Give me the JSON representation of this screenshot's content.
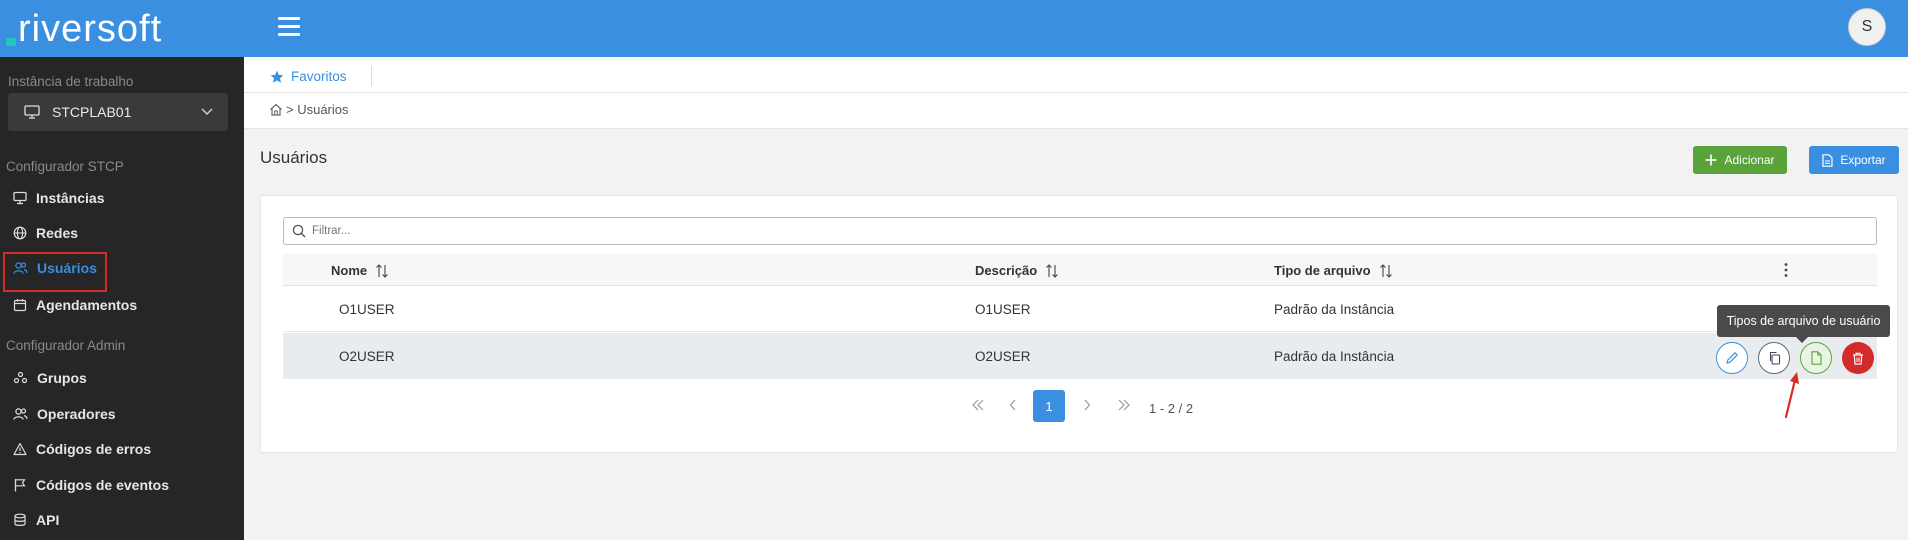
{
  "app": {
    "logo_text": "riversoft",
    "user_initial": "S"
  },
  "sidebar": {
    "instance_label": "Instância de trabalho",
    "instance_value": "STCPLAB01",
    "section_stcp": "Configurador STCP",
    "section_admin": "Configurador Admin",
    "items": [
      {
        "label": "Instâncias",
        "icon": "monitor-icon"
      },
      {
        "label": "Redes",
        "icon": "globe-icon"
      },
      {
        "label": "Usuários",
        "icon": "users-icon",
        "active": true
      },
      {
        "label": "Agendamentos",
        "icon": "calendar-icon"
      },
      {
        "label": "Grupos",
        "icon": "group-icon"
      },
      {
        "label": "Operadores",
        "icon": "operators-icon"
      },
      {
        "label": "Códigos de erros",
        "icon": "warning-icon"
      },
      {
        "label": "Códigos de eventos",
        "icon": "flag-icon"
      },
      {
        "label": "API",
        "icon": "database-icon"
      }
    ]
  },
  "favorites": {
    "label": "Favoritos"
  },
  "breadcrumb": {
    "text": "> Usuários"
  },
  "page": {
    "title": "Usuários",
    "add_label": "Adicionar",
    "export_label": "Exportar"
  },
  "table": {
    "filter_placeholder": "Filtrar...",
    "columns": [
      "Nome",
      "Descrição",
      "Tipo de arquivo"
    ],
    "rows": [
      {
        "nome": "O1USER",
        "descricao": "O1USER",
        "tipo": "Padrão da Instância"
      },
      {
        "nome": "O2USER",
        "descricao": "O2USER",
        "tipo": "Padrão da Instância"
      }
    ]
  },
  "pagination": {
    "current": "1",
    "info": "1 - 2 / 2"
  },
  "tooltip": {
    "text": "Tipos de arquivo de usuário"
  },
  "colors": {
    "primary": "#3a8fe0",
    "success": "#5aa33b",
    "danger": "#d32a2a",
    "sidebar": "#262626"
  }
}
